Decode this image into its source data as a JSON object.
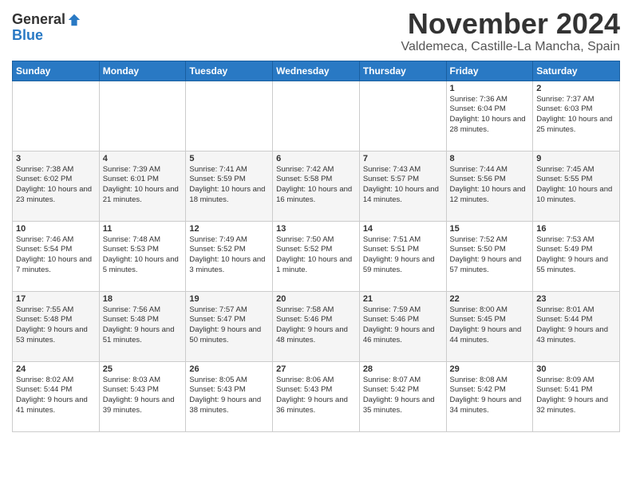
{
  "header": {
    "logo_line1": "General",
    "logo_line2": "Blue",
    "month": "November 2024",
    "location": "Valdemeca, Castille-La Mancha, Spain"
  },
  "weekdays": [
    "Sunday",
    "Monday",
    "Tuesday",
    "Wednesday",
    "Thursday",
    "Friday",
    "Saturday"
  ],
  "weeks": [
    [
      {
        "day": "",
        "detail": ""
      },
      {
        "day": "",
        "detail": ""
      },
      {
        "day": "",
        "detail": ""
      },
      {
        "day": "",
        "detail": ""
      },
      {
        "day": "",
        "detail": ""
      },
      {
        "day": "1",
        "detail": "Sunrise: 7:36 AM\nSunset: 6:04 PM\nDaylight: 10 hours and 28 minutes."
      },
      {
        "day": "2",
        "detail": "Sunrise: 7:37 AM\nSunset: 6:03 PM\nDaylight: 10 hours and 25 minutes."
      }
    ],
    [
      {
        "day": "3",
        "detail": "Sunrise: 7:38 AM\nSunset: 6:02 PM\nDaylight: 10 hours and 23 minutes."
      },
      {
        "day": "4",
        "detail": "Sunrise: 7:39 AM\nSunset: 6:01 PM\nDaylight: 10 hours and 21 minutes."
      },
      {
        "day": "5",
        "detail": "Sunrise: 7:41 AM\nSunset: 5:59 PM\nDaylight: 10 hours and 18 minutes."
      },
      {
        "day": "6",
        "detail": "Sunrise: 7:42 AM\nSunset: 5:58 PM\nDaylight: 10 hours and 16 minutes."
      },
      {
        "day": "7",
        "detail": "Sunrise: 7:43 AM\nSunset: 5:57 PM\nDaylight: 10 hours and 14 minutes."
      },
      {
        "day": "8",
        "detail": "Sunrise: 7:44 AM\nSunset: 5:56 PM\nDaylight: 10 hours and 12 minutes."
      },
      {
        "day": "9",
        "detail": "Sunrise: 7:45 AM\nSunset: 5:55 PM\nDaylight: 10 hours and 10 minutes."
      }
    ],
    [
      {
        "day": "10",
        "detail": "Sunrise: 7:46 AM\nSunset: 5:54 PM\nDaylight: 10 hours and 7 minutes."
      },
      {
        "day": "11",
        "detail": "Sunrise: 7:48 AM\nSunset: 5:53 PM\nDaylight: 10 hours and 5 minutes."
      },
      {
        "day": "12",
        "detail": "Sunrise: 7:49 AM\nSunset: 5:52 PM\nDaylight: 10 hours and 3 minutes."
      },
      {
        "day": "13",
        "detail": "Sunrise: 7:50 AM\nSunset: 5:52 PM\nDaylight: 10 hours and 1 minute."
      },
      {
        "day": "14",
        "detail": "Sunrise: 7:51 AM\nSunset: 5:51 PM\nDaylight: 9 hours and 59 minutes."
      },
      {
        "day": "15",
        "detail": "Sunrise: 7:52 AM\nSunset: 5:50 PM\nDaylight: 9 hours and 57 minutes."
      },
      {
        "day": "16",
        "detail": "Sunrise: 7:53 AM\nSunset: 5:49 PM\nDaylight: 9 hours and 55 minutes."
      }
    ],
    [
      {
        "day": "17",
        "detail": "Sunrise: 7:55 AM\nSunset: 5:48 PM\nDaylight: 9 hours and 53 minutes."
      },
      {
        "day": "18",
        "detail": "Sunrise: 7:56 AM\nSunset: 5:48 PM\nDaylight: 9 hours and 51 minutes."
      },
      {
        "day": "19",
        "detail": "Sunrise: 7:57 AM\nSunset: 5:47 PM\nDaylight: 9 hours and 50 minutes."
      },
      {
        "day": "20",
        "detail": "Sunrise: 7:58 AM\nSunset: 5:46 PM\nDaylight: 9 hours and 48 minutes."
      },
      {
        "day": "21",
        "detail": "Sunrise: 7:59 AM\nSunset: 5:46 PM\nDaylight: 9 hours and 46 minutes."
      },
      {
        "day": "22",
        "detail": "Sunrise: 8:00 AM\nSunset: 5:45 PM\nDaylight: 9 hours and 44 minutes."
      },
      {
        "day": "23",
        "detail": "Sunrise: 8:01 AM\nSunset: 5:44 PM\nDaylight: 9 hours and 43 minutes."
      }
    ],
    [
      {
        "day": "24",
        "detail": "Sunrise: 8:02 AM\nSunset: 5:44 PM\nDaylight: 9 hours and 41 minutes."
      },
      {
        "day": "25",
        "detail": "Sunrise: 8:03 AM\nSunset: 5:43 PM\nDaylight: 9 hours and 39 minutes."
      },
      {
        "day": "26",
        "detail": "Sunrise: 8:05 AM\nSunset: 5:43 PM\nDaylight: 9 hours and 38 minutes."
      },
      {
        "day": "27",
        "detail": "Sunrise: 8:06 AM\nSunset: 5:43 PM\nDaylight: 9 hours and 36 minutes."
      },
      {
        "day": "28",
        "detail": "Sunrise: 8:07 AM\nSunset: 5:42 PM\nDaylight: 9 hours and 35 minutes."
      },
      {
        "day": "29",
        "detail": "Sunrise: 8:08 AM\nSunset: 5:42 PM\nDaylight: 9 hours and 34 minutes."
      },
      {
        "day": "30",
        "detail": "Sunrise: 8:09 AM\nSunset: 5:41 PM\nDaylight: 9 hours and 32 minutes."
      }
    ]
  ]
}
